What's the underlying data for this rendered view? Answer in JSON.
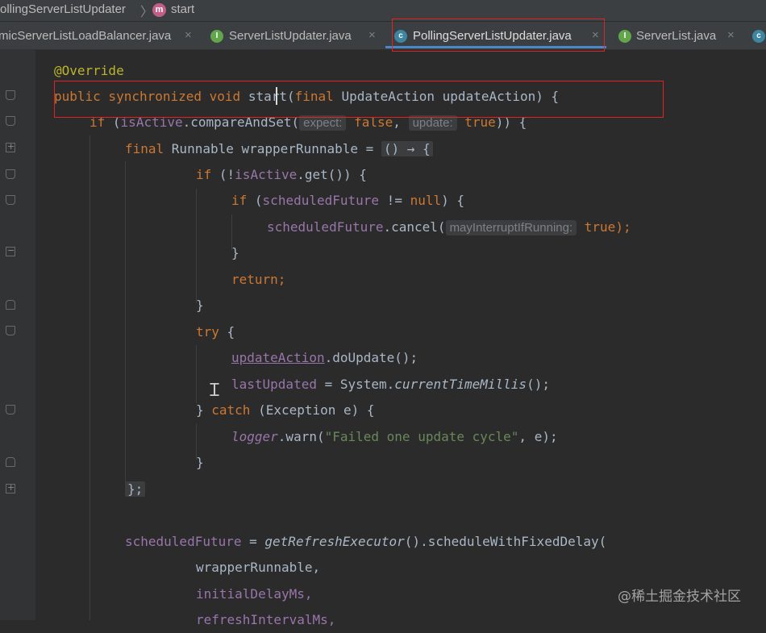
{
  "breadcrumb": {
    "class": "ollingServerListUpdater",
    "method_icon": "m",
    "method": "start"
  },
  "tabs": [
    {
      "label": "micServerListLoadBalancer.java",
      "icon": "class-icon",
      "close": "×"
    },
    {
      "label": "ServerListUpdater.java",
      "icon": "interface-icon",
      "icon_glyph": "I",
      "close": "×"
    },
    {
      "label": "PollingServerListUpdater.java",
      "icon": "class-icon",
      "icon_glyph": "c",
      "close": "×",
      "active": true
    },
    {
      "label": "ServerList.java",
      "icon": "interface-icon",
      "icon_glyph": "I",
      "close": "×"
    },
    {
      "label": "",
      "icon": "class-icon",
      "icon_glyph": "c"
    }
  ],
  "code": {
    "l1": "@Override",
    "l2": {
      "kw": "public synchronized void ",
      "name": "start",
      "rest": "(",
      "kw2": "final ",
      "params": "UpdateAction updateAction) {"
    },
    "l3": {
      "kw": "if ",
      "p1": "(",
      "fld": "isActive",
      "p2": ".compareAndSet(",
      "hint1": "expect:",
      "v1": "false",
      "c": ", ",
      "hint2": "update:",
      "v2": "true",
      "end": ")) {"
    },
    "l4": {
      "kw": "final ",
      "t": "Runnable wrapperRunnable = ",
      "fold": "() → {"
    },
    "l5": {
      "kw": "if ",
      "p1": "(!",
      "fld": "isActive",
      "p2": ".get()) {"
    },
    "l6": {
      "kw": "if ",
      "p1": "(",
      "fld": "scheduledFuture",
      "p2": " != ",
      "kw2": "null",
      "p3": ") {"
    },
    "l7": {
      "fld": "scheduledFuture",
      "p1": ".cancel(",
      "hint": "mayInterruptIfRunning:",
      "v": "true",
      "end": ");"
    },
    "l8": "}",
    "l9": "return;",
    "l10": "}",
    "l11": {
      "kw": "try",
      "p": " {"
    },
    "l12": {
      "name": "updateAction",
      "p": ".doUpdate();"
    },
    "l13": {
      "fld": "lastUpdated",
      "p1": " = System.",
      "it": "currentTimeMillis",
      "p2": "();"
    },
    "l14": {
      "p1": "} ",
      "kw": "catch",
      "p2": " (Exception e) {"
    },
    "l15": {
      "fld": "logger",
      "p1": ".warn(",
      "str": "\"Failed one update cycle\"",
      "p2": ", e);"
    },
    "l16": "}",
    "l17": "};",
    "l18": {
      "fld": "scheduledFuture",
      "p1": " = ",
      "it": "getRefreshExecutor",
      "p2": "().scheduleWithFixedDelay("
    },
    "l19": "wrapperRunnable,",
    "l20": "initialDelayMs,",
    "l21": "refreshIntervalMs,"
  },
  "watermark": "@稀土掘金技术社区",
  "colors": {
    "background": "#2b2b2b",
    "keyword": "#cc7832",
    "field": "#9876aa",
    "string": "#6a8759",
    "annotation": "#bbb529",
    "highlight_box": "#e02424"
  }
}
